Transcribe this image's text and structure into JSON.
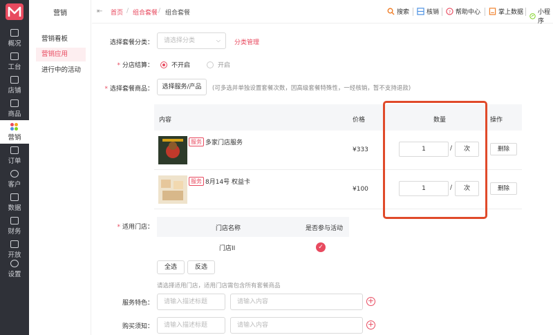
{
  "nav": {
    "items": [
      {
        "label": "概况",
        "icon": "chart-icon"
      },
      {
        "label": "工台",
        "icon": "desk-icon"
      },
      {
        "label": "店铺",
        "icon": "store-icon"
      },
      {
        "label": "商品",
        "icon": "bag-icon"
      },
      {
        "label": "营销",
        "icon": "marketing-icon"
      },
      {
        "label": "订单",
        "icon": "order-icon"
      },
      {
        "label": "客户",
        "icon": "customer-icon"
      },
      {
        "label": "数据",
        "icon": "data-icon"
      },
      {
        "label": "财务",
        "icon": "finance-icon"
      },
      {
        "label": "开放",
        "icon": "open-icon"
      },
      {
        "label": "设置",
        "icon": "settings-icon"
      }
    ]
  },
  "submenu": {
    "title": "营销",
    "items": [
      "营销看板",
      "营销应用",
      "进行中的活动"
    ]
  },
  "breadcrumb": {
    "home": "首页",
    "parent": "组合套餐",
    "current": "组合套餐",
    "sep": "/"
  },
  "toolbar": {
    "search": "搜索",
    "verify": "核销",
    "help": "帮助中心",
    "palm_data": "掌上数据",
    "mini_program": "小程序"
  },
  "form": {
    "category_label": "选择套餐分类：",
    "category_placeholder": "请选择分类",
    "category_manage": "分类管理",
    "settlement_label": "分店结算：",
    "settlement_off": "不开启",
    "settlement_on": "开启",
    "products_label": "选择套餐商品：",
    "choose_button": "选择服务/产品",
    "products_hint": "(可多选并单独设置套餐次数，因高级套餐特殊性，一经核销，暂不支持退款)",
    "stores_label": "适用门店：",
    "select_all": "全选",
    "invert": "反选",
    "stores_hint": "请选择适用门店，适用门店需包含所有套餐商品",
    "feature_label": "服务特色：",
    "notice_label": "购买须知：",
    "title_placeholder": "请输入描述标题",
    "content_placeholder": "请输入内容"
  },
  "product_table": {
    "headers": {
      "content": "内容",
      "price": "价格",
      "qty": "数量",
      "action": "操作"
    },
    "rows": [
      {
        "tag": "服务",
        "name": "多家门店服务",
        "price": "¥333",
        "qty": "1",
        "slash": "/",
        "unit": "次",
        "delete": "删除"
      },
      {
        "tag": "服务",
        "name": "8月14号 权益卡",
        "price": "¥100",
        "qty": "1",
        "slash": "/",
        "unit": "次",
        "delete": "删除"
      }
    ]
  },
  "store_table": {
    "headers": {
      "name": "门店名称",
      "join": "是否参与活动"
    },
    "rows": [
      {
        "name": "门店II",
        "joined": "✓"
      }
    ]
  },
  "colors": {
    "accent": "#e84a5f",
    "highlight": "#e04a2a",
    "nav_bg": "#2f3138"
  }
}
